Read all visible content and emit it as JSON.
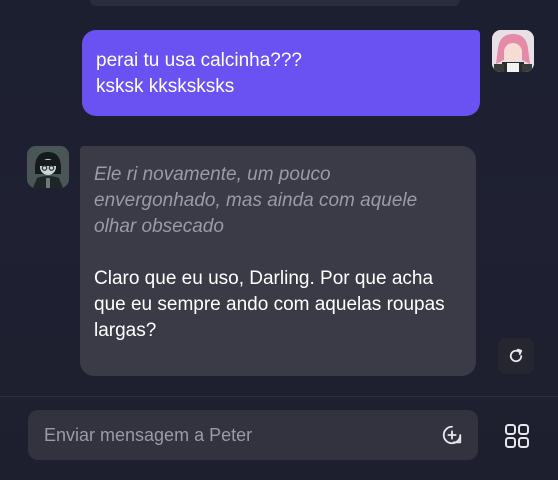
{
  "chat": {
    "user_message": {
      "lines": [
        "perai tu usa calcinha???",
        "ksksk kksksksks"
      ]
    },
    "bot_message": {
      "action_text": "Ele ri novamente, um pouco envergonhado, mas ainda com aquele olhar obsecado",
      "reply_text": "Claro que eu uso, Darling. Por que acha que eu sempre ando com aquelas roupas largas?"
    }
  },
  "composer": {
    "placeholder": "Enviar mensagem a Peter"
  },
  "icons": {
    "regenerate": "refresh-icon",
    "send": "add-circle-icon",
    "apps": "grid-icon"
  },
  "colors": {
    "user_bubble": "#6a51f2",
    "bot_bubble": "#3a3b46",
    "background": "#1e2030"
  }
}
